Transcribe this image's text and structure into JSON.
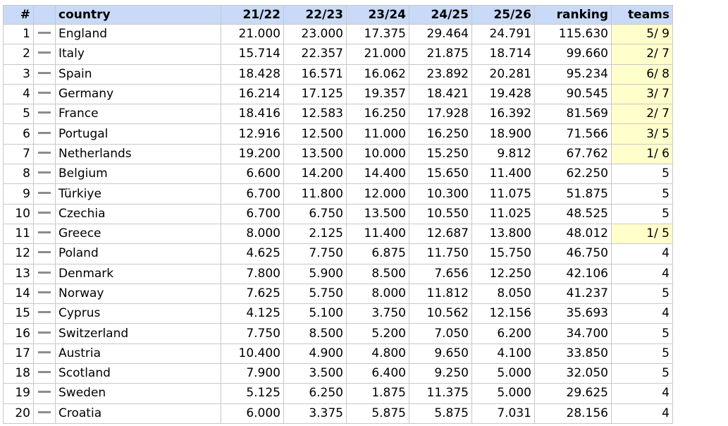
{
  "table": {
    "headers": {
      "num": "#",
      "trend": "",
      "country": "country",
      "s1": "21/22",
      "s2": "22/23",
      "s3": "23/24",
      "s4": "24/25",
      "s5": "25/26",
      "ranking": "ranking",
      "teams": "teams"
    },
    "rows": [
      {
        "num": "1",
        "country": "England",
        "s1": "21.000",
        "s2": "23.000",
        "s3": "17.375",
        "s4": "29.464",
        "s5": "24.791",
        "ranking": "115.630",
        "teams": "5/ 9",
        "highlight": true
      },
      {
        "num": "2",
        "country": "Italy",
        "s1": "15.714",
        "s2": "22.357",
        "s3": "21.000",
        "s4": "21.875",
        "s5": "18.714",
        "ranking": "99.660",
        "teams": "2/ 7",
        "highlight": true
      },
      {
        "num": "3",
        "country": "Spain",
        "s1": "18.428",
        "s2": "16.571",
        "s3": "16.062",
        "s4": "23.892",
        "s5": "20.281",
        "ranking": "95.234",
        "teams": "6/ 8",
        "highlight": true
      },
      {
        "num": "4",
        "country": "Germany",
        "s1": "16.214",
        "s2": "17.125",
        "s3": "19.357",
        "s4": "18.421",
        "s5": "19.428",
        "ranking": "90.545",
        "teams": "3/ 7",
        "highlight": true
      },
      {
        "num": "5",
        "country": "France",
        "s1": "18.416",
        "s2": "12.583",
        "s3": "16.250",
        "s4": "17.928",
        "s5": "16.392",
        "ranking": "81.569",
        "teams": "2/ 7",
        "highlight": true
      },
      {
        "num": "6",
        "country": "Portugal",
        "s1": "12.916",
        "s2": "12.500",
        "s3": "11.000",
        "s4": "16.250",
        "s5": "18.900",
        "ranking": "71.566",
        "teams": "3/ 5",
        "highlight": true
      },
      {
        "num": "7",
        "country": "Netherlands",
        "s1": "19.200",
        "s2": "13.500",
        "s3": "10.000",
        "s4": "15.250",
        "s5": "9.812",
        "ranking": "67.762",
        "teams": "1/ 6",
        "highlight": true
      },
      {
        "num": "8",
        "country": "Belgium",
        "s1": "6.600",
        "s2": "14.200",
        "s3": "14.400",
        "s4": "15.650",
        "s5": "11.400",
        "ranking": "62.250",
        "teams": "5",
        "highlight": false
      },
      {
        "num": "9",
        "country": "Türkiye",
        "s1": "6.700",
        "s2": "11.800",
        "s3": "12.000",
        "s4": "10.300",
        "s5": "11.075",
        "ranking": "51.875",
        "teams": "5",
        "highlight": false
      },
      {
        "num": "10",
        "country": "Czechia",
        "s1": "6.700",
        "s2": "6.750",
        "s3": "13.500",
        "s4": "10.550",
        "s5": "11.025",
        "ranking": "48.525",
        "teams": "5",
        "highlight": false
      },
      {
        "num": "11",
        "country": "Greece",
        "s1": "8.000",
        "s2": "2.125",
        "s3": "11.400",
        "s4": "12.687",
        "s5": "13.800",
        "ranking": "48.012",
        "teams": "1/ 5",
        "highlight": true
      },
      {
        "num": "12",
        "country": "Poland",
        "s1": "4.625",
        "s2": "7.750",
        "s3": "6.875",
        "s4": "11.750",
        "s5": "15.750",
        "ranking": "46.750",
        "teams": "4",
        "highlight": false
      },
      {
        "num": "13",
        "country": "Denmark",
        "s1": "7.800",
        "s2": "5.900",
        "s3": "8.500",
        "s4": "7.656",
        "s5": "12.250",
        "ranking": "42.106",
        "teams": "4",
        "highlight": false
      },
      {
        "num": "14",
        "country": "Norway",
        "s1": "7.625",
        "s2": "5.750",
        "s3": "8.000",
        "s4": "11.812",
        "s5": "8.050",
        "ranking": "41.237",
        "teams": "5",
        "highlight": false
      },
      {
        "num": "15",
        "country": "Cyprus",
        "s1": "4.125",
        "s2": "5.100",
        "s3": "3.750",
        "s4": "10.562",
        "s5": "12.156",
        "ranking": "35.693",
        "teams": "4",
        "highlight": false
      },
      {
        "num": "16",
        "country": "Switzerland",
        "s1": "7.750",
        "s2": "8.500",
        "s3": "5.200",
        "s4": "7.050",
        "s5": "6.200",
        "ranking": "34.700",
        "teams": "5",
        "highlight": false
      },
      {
        "num": "17",
        "country": "Austria",
        "s1": "10.400",
        "s2": "4.900",
        "s3": "4.800",
        "s4": "9.650",
        "s5": "4.100",
        "ranking": "33.850",
        "teams": "5",
        "highlight": false
      },
      {
        "num": "18",
        "country": "Scotland",
        "s1": "7.900",
        "s2": "3.500",
        "s3": "6.400",
        "s4": "9.250",
        "s5": "5.000",
        "ranking": "32.050",
        "teams": "5",
        "highlight": false
      },
      {
        "num": "19",
        "country": "Sweden",
        "s1": "5.125",
        "s2": "6.250",
        "s3": "1.875",
        "s4": "11.375",
        "s5": "5.000",
        "ranking": "29.625",
        "teams": "4",
        "highlight": false
      },
      {
        "num": "20",
        "country": "Croatia",
        "s1": "6.000",
        "s2": "3.375",
        "s3": "5.875",
        "s4": "5.875",
        "s5": "7.031",
        "ranking": "28.156",
        "teams": "4",
        "highlight": false
      }
    ]
  },
  "colors": {
    "header_bg": "#c9daf8",
    "teams_highlight": "#ffffcc",
    "trend_dash": "#8c8c8c"
  },
  "icons": {
    "trend": "unchanged-dash-icon"
  }
}
